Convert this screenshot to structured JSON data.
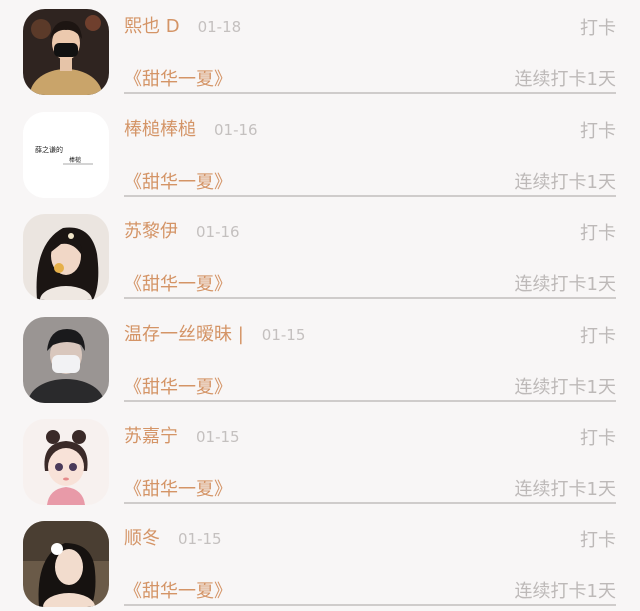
{
  "entries": [
    {
      "name": "熙也 D",
      "date": "01-18",
      "action": "打卡",
      "title": "《甜华一夏》",
      "streak": "连续打卡1天",
      "avatar_bg": "#3a2a22"
    },
    {
      "name": "棒槌棒槌",
      "date": "01-16",
      "action": "打卡",
      "title": "《甜华一夏》",
      "streak": "连续打卡1天",
      "avatar_bg": "#ffffff",
      "avatar_text_1": "薛之谦的",
      "avatar_text_2": "棒槌"
    },
    {
      "name": "苏黎伊",
      "date": "01-16",
      "action": "打卡",
      "title": "《甜华一夏》",
      "streak": "连续打卡1天",
      "avatar_bg": "#e9e2dc"
    },
    {
      "name": "温存一丝暧昧 |",
      "date": "01-15",
      "action": "打卡",
      "title": "《甜华一夏》",
      "streak": "连续打卡1天",
      "avatar_bg": "#8a8583"
    },
    {
      "name": "苏嘉宁",
      "date": "01-15",
      "action": "打卡",
      "title": "《甜华一夏》",
      "streak": "连续打卡1天",
      "avatar_bg": "#f6f0ee"
    },
    {
      "name": "顺冬",
      "date": "01-15",
      "action": "打卡",
      "title": "《甜华一夏》",
      "streak": "连续打卡1天",
      "avatar_bg": "#5a4a3c"
    }
  ]
}
